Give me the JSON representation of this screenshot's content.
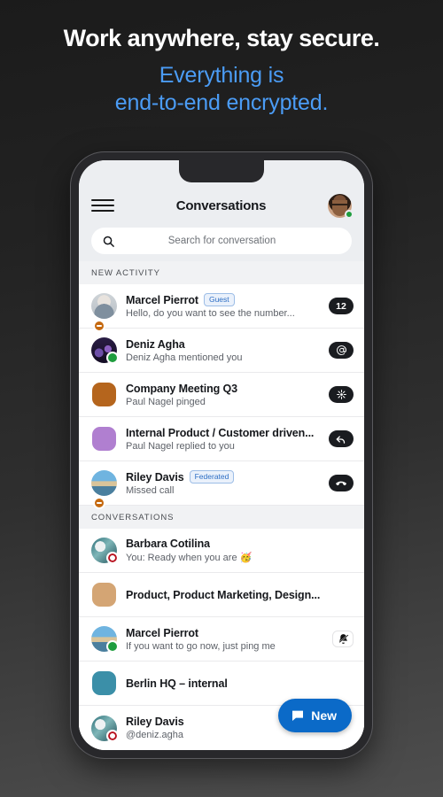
{
  "promo": {
    "headline": "Work anywhere, stay secure.",
    "subhead_line1": "Everything is",
    "subhead_line2": "end-to-end encrypted.",
    "headline_color": "#ffffff",
    "subhead_color": "#4b9cf5"
  },
  "app": {
    "title": "Conversations",
    "menu_icon": "hamburger-icon",
    "avatar_status": "online",
    "accent_color": "#0b6ac8",
    "search": {
      "placeholder": "Search for conversation",
      "icon": "search-icon"
    },
    "fab": {
      "label": "New",
      "icon": "chat-bubble-icon",
      "color": "#0b6ac8"
    }
  },
  "sections": [
    {
      "header": "NEW ACTIVITY",
      "rows": [
        {
          "name": "Marcel Pierrot",
          "tag": "Guest",
          "subtitle": "Hello, do you want to see the number...",
          "avatar_type": "photo-marcel",
          "presence": "dnd",
          "badge_kind": "count",
          "badge_text": "12"
        },
        {
          "name": "Deniz Agha",
          "tag": "",
          "subtitle": "Deniz Agha mentioned you",
          "avatar_type": "photo-deniz",
          "presence": "online",
          "badge_kind": "mention",
          "badge_text": "@"
        },
        {
          "name": "Company Meeting Q3",
          "tag": "",
          "subtitle": "Paul Nagel pinged",
          "avatar_type": "color-orange",
          "avatar_color": "#b5651d",
          "presence": "",
          "badge_kind": "ping",
          "badge_text": ""
        },
        {
          "name": "Internal Product / Customer driven...",
          "tag": "",
          "subtitle": "Paul Nagel replied to you",
          "avatar_type": "color-purple",
          "avatar_color": "#b07fd0",
          "presence": "",
          "badge_kind": "reply",
          "badge_text": ""
        },
        {
          "name": "Riley Davis",
          "tag": "Federated",
          "subtitle": "Missed call",
          "avatar_type": "photo-beach",
          "presence": "dnd",
          "badge_kind": "missed-call",
          "badge_text": ""
        }
      ]
    },
    {
      "header": "CONVERSATIONS",
      "rows": [
        {
          "name": "Barbara Cotilina",
          "tag": "",
          "subtitle": "You: Ready when you are 🥳",
          "avatar_type": "photo-wave",
          "presence": "away",
          "badge_kind": "none",
          "badge_text": ""
        },
        {
          "name": "Product, Product Marketing, Design...",
          "tag": "",
          "subtitle": "",
          "avatar_type": "color-tan",
          "avatar_color": "#d4a574",
          "presence": "",
          "badge_kind": "none",
          "badge_text": ""
        },
        {
          "name": "Marcel Pierrot",
          "tag": "",
          "subtitle": "If you want to go now, just ping me",
          "avatar_type": "photo-beach",
          "presence": "online",
          "badge_kind": "muted-bell",
          "badge_text": ""
        },
        {
          "name": "Berlin HQ – internal",
          "tag": "",
          "subtitle": "",
          "avatar_type": "color-teal",
          "avatar_color": "#3b8fa8",
          "presence": "",
          "badge_kind": "none",
          "badge_text": ""
        },
        {
          "name": "Riley Davis",
          "tag": "",
          "subtitle": "@deniz.agha",
          "avatar_type": "photo-wave",
          "presence": "away",
          "badge_kind": "none",
          "badge_text": ""
        }
      ]
    }
  ]
}
